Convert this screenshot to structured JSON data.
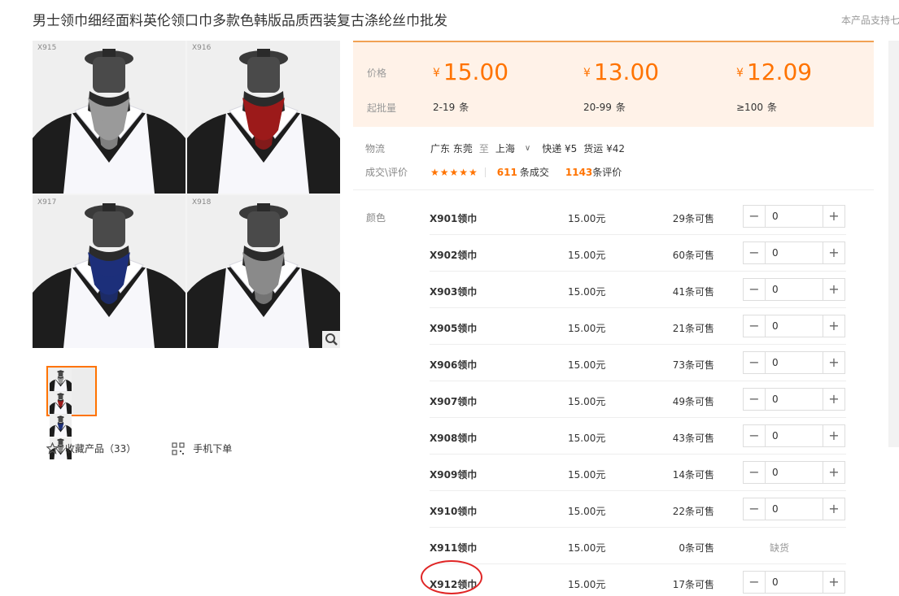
{
  "product": {
    "title": "男士领巾细经面料英伦领口巾多款色韩版品质西装复古涤纶丝巾批发",
    "support_text": "本产品支持七"
  },
  "gallery": {
    "tiles": [
      {
        "code": "X915",
        "accent": "#9a9a9a"
      },
      {
        "code": "X916",
        "accent": "#9c1a1a"
      },
      {
        "code": "X917",
        "accent": "#1d2f7a"
      },
      {
        "code": "X918",
        "accent": "#8a8a8a"
      }
    ],
    "favorite_label": "收藏产品（33）",
    "mobile_label": "手机下单"
  },
  "pricing": {
    "price_label": "价格",
    "moq_label": "起批量",
    "currency": "¥",
    "tiers": [
      {
        "price": "15.00",
        "range": "2-19",
        "unit": "条"
      },
      {
        "price": "13.00",
        "range": "20-99",
        "unit": "条"
      },
      {
        "price": "12.09",
        "range": "≥100",
        "unit": "条"
      }
    ]
  },
  "logistics": {
    "label": "物流",
    "from": "广东 东莞",
    "to_word": "至",
    "to": "上海",
    "express": "快递 ¥5",
    "freight": "货运 ¥42"
  },
  "rating": {
    "label": "成交\\评价",
    "stars": "★★★★★",
    "deals_count": "611",
    "deals_suffix": "条成交",
    "reviews_count": "1143",
    "reviews_suffix": "条评价"
  },
  "colors": {
    "label": "颜色",
    "skus": [
      {
        "name": "X901领巾",
        "price": "15.00元",
        "stock": "29条可售",
        "qty": "0"
      },
      {
        "name": "X902领巾",
        "price": "15.00元",
        "stock": "60条可售",
        "qty": "0"
      },
      {
        "name": "X903领巾",
        "price": "15.00元",
        "stock": "41条可售",
        "qty": "0"
      },
      {
        "name": "X905领巾",
        "price": "15.00元",
        "stock": "21条可售",
        "qty": "0"
      },
      {
        "name": "X906领巾",
        "price": "15.00元",
        "stock": "73条可售",
        "qty": "0"
      },
      {
        "name": "X907领巾",
        "price": "15.00元",
        "stock": "49条可售",
        "qty": "0"
      },
      {
        "name": "X908领巾",
        "price": "15.00元",
        "stock": "43条可售",
        "qty": "0"
      },
      {
        "name": "X909领巾",
        "price": "15.00元",
        "stock": "14条可售",
        "qty": "0"
      },
      {
        "name": "X910领巾",
        "price": "15.00元",
        "stock": "22条可售",
        "qty": "0"
      },
      {
        "name": "X911领巾",
        "price": "15.00元",
        "stock": "0条可售",
        "out_of_stock": "缺货"
      },
      {
        "name": "X912领巾",
        "price": "15.00元",
        "stock": "17条可售",
        "qty": "0"
      }
    ]
  },
  "theme": {
    "accent": "#ff7300",
    "price_bg": "#fff2e8",
    "highlight_circle": "#e02626"
  }
}
